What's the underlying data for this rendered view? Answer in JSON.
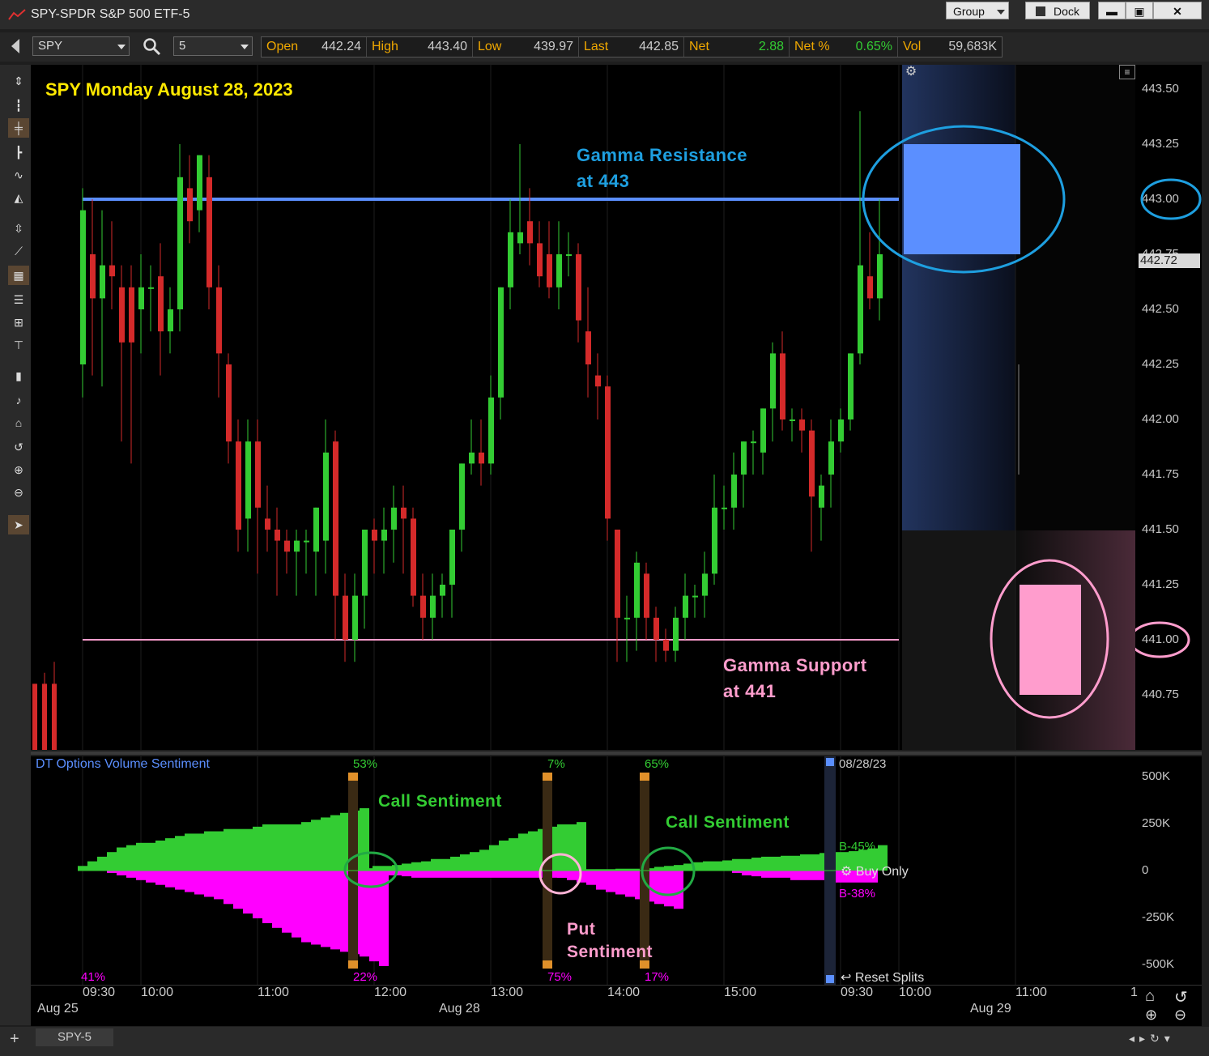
{
  "window": {
    "title": "SPY-SPDR S&P 500 ETF-5",
    "group_label": "Group",
    "dock_label": "Dock",
    "min_icon": "minimize-icon",
    "max_icon": "maximize-icon",
    "close_icon": "close-icon"
  },
  "toolbar": {
    "symbol": "SPY",
    "interval": "5"
  },
  "quote": {
    "open_label": "Open",
    "open": "442.24",
    "high_label": "High",
    "high": "443.40",
    "low_label": "Low",
    "low": "439.97",
    "last_label": "Last",
    "last": "442.85",
    "net_label": "Net",
    "net": "2.88",
    "netpct_label": "Net %",
    "netpct": "0.65%",
    "vol_label": "Vol",
    "vol": "59,683K"
  },
  "chart_title": "SPY Monday August 28, 2023",
  "annotations": {
    "gamma_res_1": "Gamma Resistance",
    "gamma_res_2": "at 443",
    "gamma_sup_1": "Gamma Support",
    "gamma_sup_2": "at 441",
    "call_sent_1": "Call Sentiment",
    "call_sent_2": "Call Sentiment",
    "put_sent_1": "Put",
    "put_sent_2": "Sentiment"
  },
  "price_axis": {
    "ticks": [
      "443.50",
      "443.25",
      "443.00",
      "442.75",
      "442.50",
      "442.25",
      "442.00",
      "441.75",
      "441.50",
      "441.25",
      "441.00",
      "440.75"
    ],
    "last_marker": "442.72"
  },
  "indicator": {
    "name": "DT Options Volume Sentiment",
    "date_label": "08/28/23",
    "b_call": "B-45%",
    "b_put": "B-38%",
    "buy_only": "Buy Only",
    "reset_splits": "Reset Splits",
    "axis_ticks": [
      "500K",
      "250K",
      "0",
      "-250K",
      "-500K"
    ],
    "top_pcts": [
      "53%",
      "7%",
      "65%"
    ],
    "bottom_pcts": [
      "41%",
      "22%",
      "75%",
      "17%"
    ]
  },
  "time_axis": {
    "ticks": [
      "09:30",
      "10:00",
      "11:00",
      "12:00",
      "13:00",
      "14:00",
      "15:00",
      "09:30",
      "10:00",
      "11:00",
      "1"
    ],
    "dates": [
      "Aug 25",
      "Aug 28",
      "Aug 29"
    ]
  },
  "status": {
    "tab": "SPY-5"
  },
  "colors": {
    "up": "#33cc33",
    "down": "#d42a2a",
    "resistance": "#5b8fff",
    "support": "#ff9dcd",
    "call": "#33cc33",
    "put": "#ff00ff",
    "accent_label": "#f0a800"
  },
  "chart_data": {
    "type": "candlestick",
    "interval_minutes": 5,
    "levels": {
      "resistance": 443.0,
      "support": 441.0
    },
    "ylim": [
      440.5,
      443.6
    ],
    "candles": [
      [
        442.25,
        442.95,
        442.1,
        443.05
      ],
      [
        442.75,
        442.55,
        442.2,
        443.0
      ],
      [
        442.55,
        442.7,
        442.15,
        442.95
      ],
      [
        442.7,
        442.65,
        442.5,
        442.9
      ],
      [
        442.6,
        442.35,
        441.9,
        442.7
      ],
      [
        442.6,
        442.35,
        441.8,
        442.7
      ],
      [
        442.5,
        442.6,
        442.3,
        442.75
      ],
      [
        442.6,
        442.6,
        442.4,
        442.7
      ],
      [
        442.65,
        442.4,
        442.2,
        442.8
      ],
      [
        442.4,
        442.5,
        442.3,
        442.6
      ],
      [
        442.5,
        443.1,
        442.4,
        443.25
      ],
      [
        443.05,
        442.9,
        442.8,
        443.2
      ],
      [
        442.95,
        443.2,
        442.85,
        443.2
      ],
      [
        443.1,
        442.6,
        442.5,
        443.2
      ],
      [
        442.6,
        442.3,
        442.1,
        442.7
      ],
      [
        442.25,
        441.9,
        441.8,
        442.3
      ],
      [
        441.9,
        441.5,
        441.4,
        442.0
      ],
      [
        441.55,
        441.9,
        441.4,
        442.0
      ],
      [
        441.9,
        441.6,
        441.3,
        442.0
      ],
      [
        441.55,
        441.5,
        441.4,
        441.7
      ],
      [
        441.5,
        441.45,
        441.2,
        441.6
      ],
      [
        441.45,
        441.4,
        441.3,
        441.5
      ],
      [
        441.4,
        441.45,
        441.2,
        441.5
      ],
      [
        441.45,
        441.45,
        441.3,
        441.5
      ],
      [
        441.4,
        441.6,
        441.2,
        441.6
      ],
      [
        441.45,
        441.85,
        441.3,
        442.0
      ],
      [
        441.9,
        441.2,
        441.0,
        441.95
      ],
      [
        441.2,
        441.0,
        440.9,
        441.3
      ],
      [
        441.0,
        441.2,
        440.9,
        441.3
      ],
      [
        441.2,
        441.5,
        441.05,
        441.5
      ],
      [
        441.5,
        441.45,
        441.3,
        441.55
      ],
      [
        441.45,
        441.5,
        441.3,
        441.6
      ],
      [
        441.5,
        441.6,
        441.35,
        441.7
      ],
      [
        441.6,
        441.55,
        441.3,
        441.7
      ],
      [
        441.55,
        441.2,
        441.15,
        441.6
      ],
      [
        441.2,
        441.1,
        441.0,
        441.3
      ],
      [
        441.1,
        441.2,
        441.0,
        441.3
      ],
      [
        441.2,
        441.25,
        441.1,
        441.3
      ],
      [
        441.25,
        441.5,
        441.1,
        441.5
      ],
      [
        441.5,
        441.8,
        441.4,
        441.8
      ],
      [
        441.8,
        441.85,
        441.75,
        442.0
      ],
      [
        441.85,
        441.8,
        441.7,
        442.0
      ],
      [
        441.8,
        442.1,
        441.75,
        442.2
      ],
      [
        442.1,
        442.6,
        442.0,
        442.6
      ],
      [
        442.6,
        442.85,
        442.5,
        443.0
      ],
      [
        442.8,
        442.85,
        442.75,
        443.25
      ],
      [
        442.9,
        442.8,
        442.7,
        443.05
      ],
      [
        442.8,
        442.65,
        442.6,
        442.9
      ],
      [
        442.75,
        442.6,
        442.55,
        442.9
      ],
      [
        442.6,
        442.75,
        442.5,
        442.9
      ],
      [
        442.75,
        442.75,
        442.65,
        442.85
      ],
      [
        442.75,
        442.45,
        442.35,
        442.8
      ],
      [
        442.4,
        442.25,
        442.1,
        442.6
      ],
      [
        442.2,
        442.15,
        442.0,
        442.3
      ],
      [
        442.15,
        441.55,
        441.45,
        442.2
      ],
      [
        441.5,
        441.1,
        440.9,
        441.5
      ],
      [
        441.1,
        441.1,
        440.9,
        441.2
      ],
      [
        441.1,
        441.35,
        440.95,
        441.4
      ],
      [
        441.3,
        441.1,
        441.0,
        441.35
      ],
      [
        441.1,
        441.0,
        440.9,
        441.15
      ],
      [
        441.0,
        440.95,
        440.9,
        441.05
      ],
      [
        440.95,
        441.1,
        440.9,
        441.15
      ],
      [
        441.1,
        441.2,
        441.0,
        441.3
      ],
      [
        441.2,
        441.2,
        441.1,
        441.25
      ],
      [
        441.2,
        441.3,
        441.1,
        441.4
      ],
      [
        441.3,
        441.6,
        441.25,
        441.75
      ],
      [
        441.6,
        441.6,
        441.5,
        441.7
      ],
      [
        441.6,
        441.75,
        441.5,
        441.85
      ],
      [
        441.75,
        441.9,
        441.6,
        441.9
      ],
      [
        441.9,
        441.9,
        441.75,
        441.95
      ],
      [
        441.85,
        442.05,
        441.75,
        442.05
      ],
      [
        442.05,
        442.3,
        441.9,
        442.35
      ],
      [
        442.3,
        442.0,
        441.95,
        442.4
      ],
      [
        442.0,
        442.0,
        441.9,
        442.05
      ],
      [
        442.0,
        441.95,
        441.85,
        442.05
      ],
      [
        441.95,
        441.65,
        441.4,
        442.0
      ],
      [
        441.6,
        441.7,
        441.45,
        441.75
      ],
      [
        441.75,
        441.9,
        441.6,
        442.0
      ],
      [
        441.9,
        442.0,
        441.85,
        442.05
      ],
      [
        442.0,
        442.3,
        441.95,
        442.3
      ],
      [
        442.3,
        442.7,
        442.25,
        443.4
      ],
      [
        442.65,
        442.55,
        442.5,
        442.85
      ],
      [
        442.55,
        442.75,
        442.45,
        443.0
      ]
    ],
    "prior_day_candles": [
      [
        440.8,
        440.5,
        440.4,
        440.8
      ],
      [
        440.8,
        440.5,
        440.4,
        440.85
      ],
      [
        440.8,
        440.5,
        440.4,
        440.9
      ]
    ],
    "sentiment": {
      "call_segments": [
        [
          10,
          20,
          30,
          40,
          50,
          55,
          60,
          60,
          65,
          70,
          75,
          80,
          80,
          85,
          85,
          90,
          90,
          90,
          95,
          100,
          100,
          100,
          100,
          105,
          110,
          115,
          120,
          125,
          130,
          135
        ],
        [
          5,
          5,
          10,
          10,
          12,
          15,
          18,
          20,
          25,
          25,
          30,
          35,
          40,
          45,
          55,
          65,
          70,
          80,
          85,
          90,
          95,
          100,
          100,
          105
        ],
        [
          2,
          2,
          3,
          3,
          3,
          3,
          3,
          4,
          4,
          4
        ],
        [
          5,
          8,
          10,
          12,
          15,
          18,
          20,
          20,
          22,
          25,
          25,
          28,
          30,
          30,
          32,
          32,
          35,
          35,
          38,
          40,
          40,
          42,
          45,
          48,
          55
        ]
      ],
      "put_segments": [
        [
          0,
          0,
          0,
          5,
          10,
          15,
          20,
          25,
          30,
          35,
          40,
          45,
          50,
          55,
          60,
          70,
          80,
          90,
          100,
          110,
          120,
          130,
          140,
          150,
          155,
          160,
          165,
          170,
          175,
          180,
          190,
          200
        ],
        [
          5,
          5,
          5,
          10,
          10,
          12,
          15,
          15,
          15,
          15,
          15,
          15,
          15,
          15,
          15,
          15,
          15,
          15,
          15,
          15,
          15,
          15,
          15,
          18
        ],
        [
          10,
          15,
          20,
          25,
          30,
          40,
          45,
          50,
          55,
          60,
          65,
          70,
          75,
          80
        ],
        [
          0,
          0,
          0,
          0,
          0,
          0,
          0,
          0,
          0,
          5,
          10,
          12,
          15,
          15,
          15,
          20,
          20,
          20,
          20,
          25,
          25,
          25,
          25,
          25
        ]
      ]
    }
  }
}
